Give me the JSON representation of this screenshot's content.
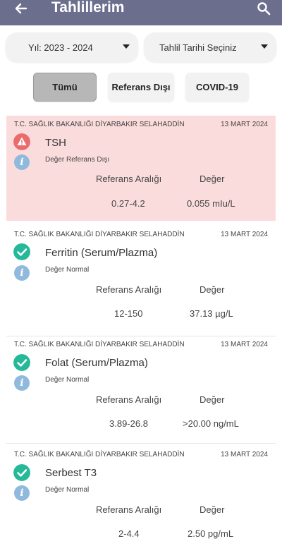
{
  "header": {
    "title": "Tahlillerim",
    "back_icon": "arrow-left-icon",
    "search_icon": "search-icon"
  },
  "filters": {
    "year": "Yıl: 2023 - 2024",
    "date": "Tahlil Tarihi Seçiniz"
  },
  "chips": [
    {
      "label": "Tümü",
      "selected": true
    },
    {
      "label": "Referans Dışı",
      "selected": false
    },
    {
      "label": "COVID-19",
      "selected": false
    }
  ],
  "columns": {
    "range": "Referans Aralığı",
    "value": "Değer"
  },
  "results": [
    {
      "hospital": "T.C. SAĞLIK BAKANLIĞI DİYARBAKIR SELAHADDİN",
      "date": "13 MART 2024",
      "name": "TSH",
      "status": "Değer Referans Dışı",
      "status_type": "warning",
      "range": "0.27-4.2",
      "value": "0.055 mIu/L"
    },
    {
      "hospital": "T.C. SAĞLIK BAKANLIĞI DİYARBAKIR SELAHADDİN",
      "date": "13 MART 2024",
      "name": "Ferritin (Serum/Plazma)",
      "status": "Değer Normal",
      "status_type": "ok",
      "range": "12-150",
      "value": "37.13 µg/L"
    },
    {
      "hospital": "T.C. SAĞLIK BAKANLIĞI DİYARBAKIR SELAHADDİN",
      "date": "13 MART 2024",
      "name": "Folat (Serum/Plazma)",
      "status": "Değer Normal",
      "status_type": "ok",
      "range": "3.89-26.8",
      "value": ">20.00 ng/mL"
    },
    {
      "hospital": "T.C. SAĞLIK BAKANLIĞI DİYARBAKIR SELAHADDİN",
      "date": "13 MART 2024",
      "name": "Serbest T3",
      "status": "Değer Normal",
      "status_type": "ok",
      "range": "2-4.4",
      "value": "2.50 pg/mL"
    }
  ],
  "colors": {
    "appbar": "#6b6f8d",
    "ok": "#25b99a",
    "warning": "#ea6b6b",
    "info": "#8fb9dd",
    "abnormal_bg": "#fbdcdc"
  }
}
